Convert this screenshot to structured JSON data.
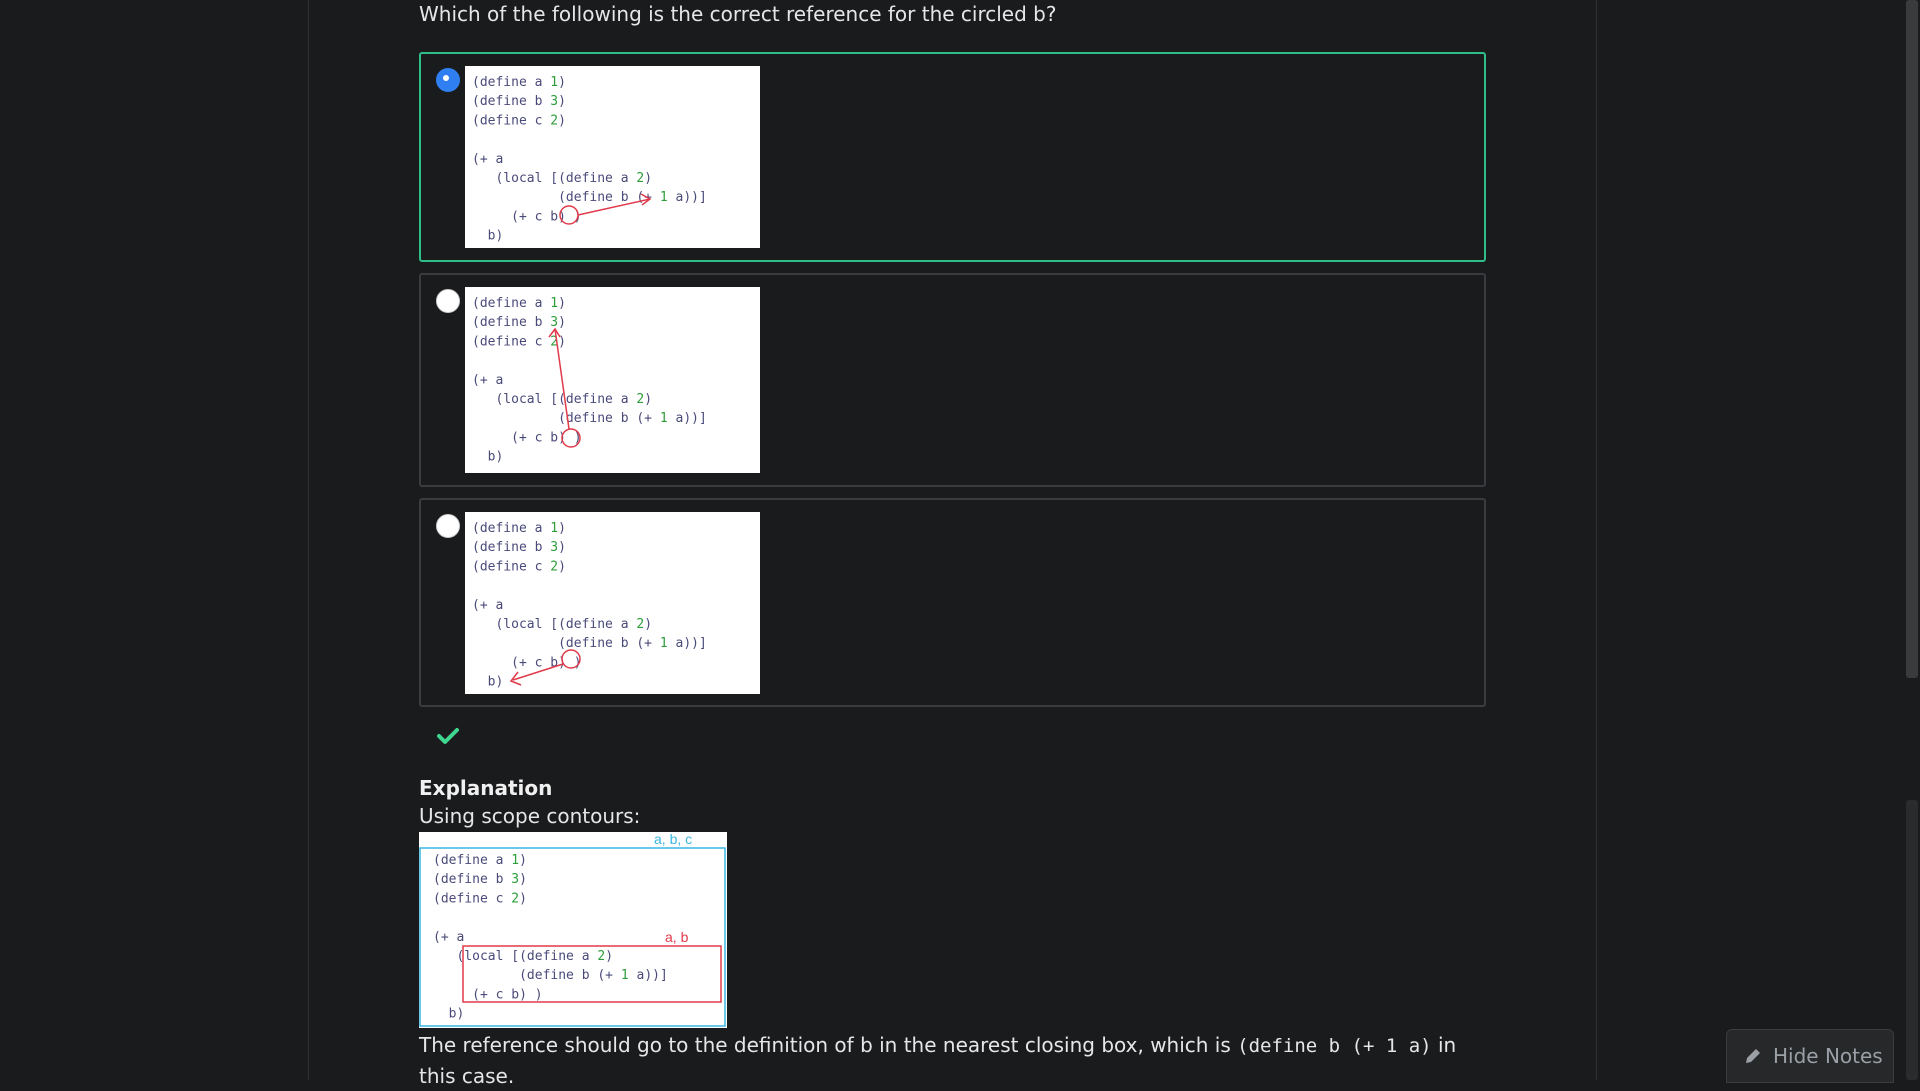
{
  "question": {
    "text": "Which of the following is the correct reference for the circled b?"
  },
  "options": [
    {
      "selected": true,
      "code": [
        "(define a 1)",
        "(define b 3)",
        "(define c 2)",
        "",
        "(+ a",
        "   (local [(define a 2)",
        "           (define b (+ 1 a))]",
        "     (+ c b) )",
        "  b)"
      ]
    },
    {
      "selected": false,
      "code": [
        "(define a 1)",
        "(define b 3)",
        "(define c 2)",
        "",
        "(+ a",
        "   (local [(define a 2)",
        "           (define b (+ 1 a))]",
        "     (+ c b) )",
        "  b)"
      ]
    },
    {
      "selected": false,
      "code": [
        "(define a 1)",
        "(define b 3)",
        "(define c 2)",
        "",
        "(+ a",
        "   (local [(define a 2)",
        "           (define b (+ 1 a))]",
        "     (+ c b) )",
        "  b)"
      ]
    }
  ],
  "explanation": {
    "title": "Explanation",
    "subtitle": "Using scope contours:",
    "outer_label": "a, b, c",
    "inner_label": "a, b",
    "body_before": "The reference should go to the definition of b in the nearest closing box, which is ",
    "body_code": "(define b (+ 1 a)",
    "body_after": " in this case."
  },
  "hide_notes": {
    "label": "Hide Notes",
    "icon": "pencil-icon"
  },
  "colors": {
    "selected_border": "#2fbd8a",
    "radio_checked": "#2f7ff2",
    "check": "#3fd68f",
    "arrow": "#e03a4a",
    "outer_box": "#3ab6e0",
    "inner_box": "#e03a4a"
  }
}
